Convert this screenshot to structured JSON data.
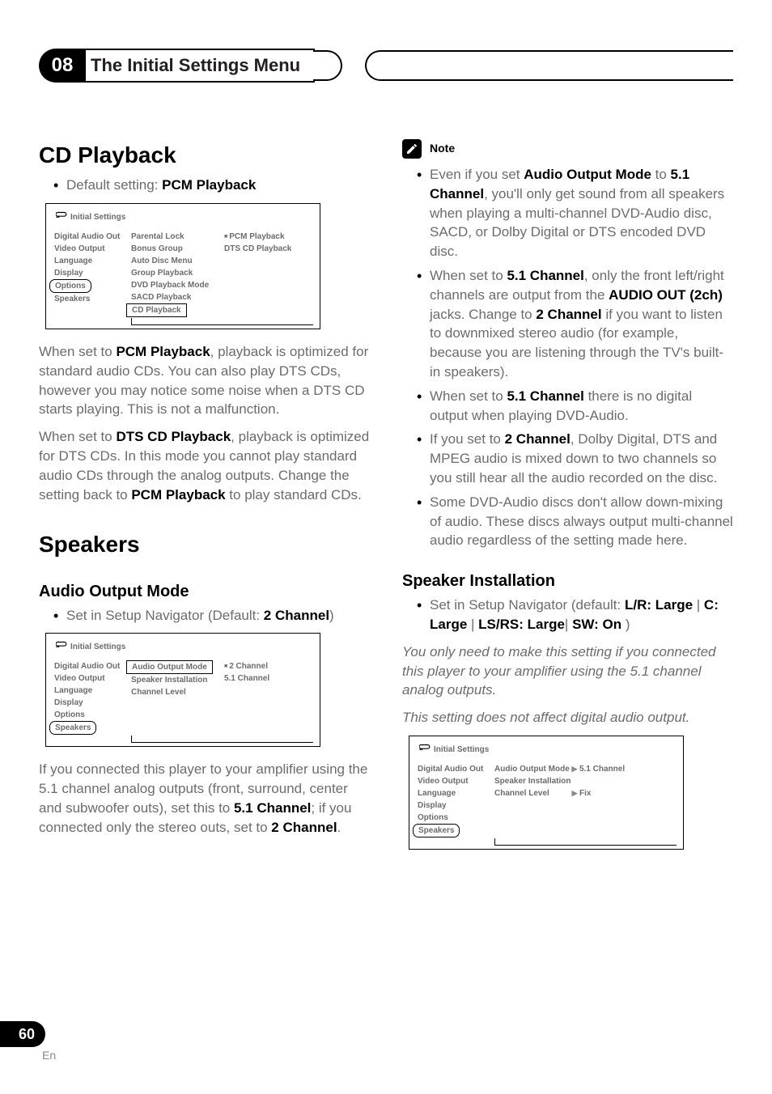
{
  "chapter_number": "08",
  "chapter_title": "The Initial Settings Menu",
  "page_number": "60",
  "page_lang": "En",
  "left": {
    "h_cd": "CD Playback",
    "cd_default_prefix": "Default setting: ",
    "cd_default_value": "PCM Playback",
    "osd1": {
      "title": "Initial Settings",
      "col1": [
        "Digital Audio Out",
        "Video Output",
        "Language",
        "Display",
        "Options",
        "Speakers"
      ],
      "col1_selected_index": 4,
      "col2": [
        "Parental  Lock",
        "Bonus Group",
        "Auto Disc Menu",
        "Group Playback",
        "DVD Playback Mode",
        "SACD Playback",
        "CD Playback"
      ],
      "col2_selected_index": 6,
      "col3": [
        "PCM Playback",
        "DTS CD Playback"
      ],
      "col3_marked_index": 0
    },
    "cd_p1_a": "When set to ",
    "cd_p1_b": "PCM Playback",
    "cd_p1_c": ", playback is optimized for standard audio CDs. You can also play DTS CDs, however you may notice some noise when a DTS CD starts playing. This is not a malfunction.",
    "cd_p2_a": "When set to ",
    "cd_p2_b": "DTS CD Playback",
    "cd_p2_c": ", playback is optimized for DTS CDs. In this mode you cannot play standard audio CDs through the analog outputs. Change the setting back to ",
    "cd_p2_d": "PCM Playback",
    "cd_p2_e": " to play standard CDs.",
    "h_spk": "Speakers",
    "h_aomode": "Audio Output Mode",
    "aomode_bullet_a": "Set in Setup Navigator (Default: ",
    "aomode_bullet_b": "2 Channel",
    "aomode_bullet_c": ")",
    "osd2": {
      "title": "Initial Settings",
      "col1": [
        "Digital Audio Out",
        "Video Output",
        "Language",
        "Display",
        "Options",
        "Speakers"
      ],
      "col1_selected_index": 5,
      "col2": [
        "Audio Output Mode",
        "Speaker Installation",
        "Channel Level"
      ],
      "col2_selected_index": 0,
      "col3": [
        "2 Channel",
        "5.1 Channel"
      ],
      "col3_marked_index": 0
    },
    "ao_p1_a": "If you connected this player to your amplifier using the 5.1 channel analog outputs (front, surround, center and subwoofer outs), set this to ",
    "ao_p1_b": "5.1 Channel",
    "ao_p1_c": "; if you connected only the stereo outs, set to ",
    "ao_p1_d": "2 Channel",
    "ao_p1_e": "."
  },
  "right": {
    "note_label": "Note",
    "n1_a": "Even if you set ",
    "n1_b": "Audio Output Mode",
    "n1_c": " to ",
    "n1_d": "5.1 Channel",
    "n1_e": ", you'll only get sound from all speakers when playing a multi-channel DVD-Audio disc, SACD, or Dolby Digital or DTS encoded DVD disc.",
    "n2_a": "When set to ",
    "n2_b": "5.1 Channel",
    "n2_c": ", only the front left/right channels are output from the ",
    "n2_d": "AUDIO OUT (2ch)",
    "n2_e": " jacks. Change to ",
    "n2_f": "2 Channel",
    "n2_g": " if you want to listen to downmixed stereo audio (for example, because you are listening through the TV's built-in speakers).",
    "n3_a": "When set to ",
    "n3_b": "5.1 Channel",
    "n3_c": " there is no digital output when playing DVD-Audio.",
    "n4_a": "If you set to ",
    "n4_b": "2 Channel",
    "n4_c": ", Dolby Digital, DTS and MPEG audio is mixed down to two channels so you still hear all the audio recorded on the disc.",
    "n5": "Some DVD-Audio discs don't allow down-mixing of audio. These discs always output multi-channel audio regardless of the setting made here.",
    "h_spkinst": "Speaker Installation",
    "spkinst_bullet_a": "Set in Setup Navigator (default: ",
    "spkinst_bullet_b": "L/R: Large",
    "spkinst_bullet_c": " | ",
    "spkinst_bullet_d": "C: Large",
    "spkinst_bullet_e": " | ",
    "spkinst_bullet_f": "LS/RS: Large",
    "spkinst_bullet_g": "| ",
    "spkinst_bullet_h": "SW: On",
    "spkinst_bullet_i": " )",
    "spk_p1": "You only need to make this setting if you connected this player to your amplifier using the 5.1 channel analog outputs.",
    "spk_p2": "This setting does not affect digital audio output.",
    "osd3": {
      "title": "Initial Settings",
      "col1": [
        "Digital Audio Out",
        "Video Output",
        "Language",
        "Display",
        "Options",
        "Speakers"
      ],
      "col1_selected_index": 5,
      "col2_row0": {
        "label": "Audio Output Mode",
        "value": "5.1 Channel"
      },
      "col2_row1": "Speaker Installation",
      "col2_row2": {
        "label": "Channel Level",
        "value": "Fix"
      }
    }
  }
}
